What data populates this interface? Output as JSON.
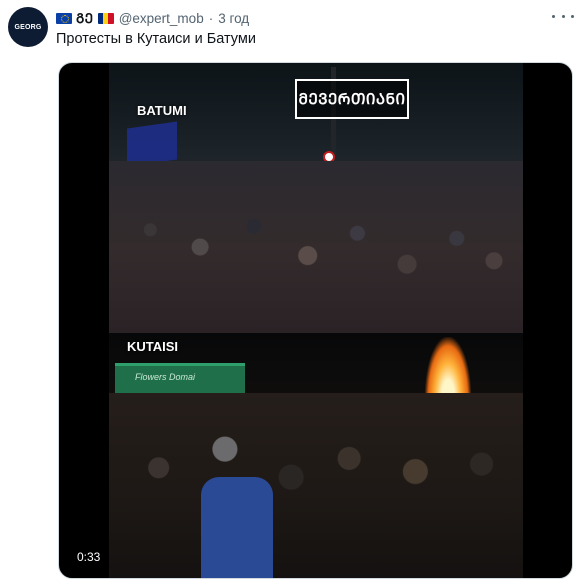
{
  "avatar": {
    "text": "GEORG"
  },
  "header": {
    "display_name": "ᲒᲔ",
    "handle": "@expert_mob",
    "separator": "·",
    "time": "3 год",
    "flags": [
      "eu-flag-icon",
      "romania-flag-icon"
    ]
  },
  "tweet": {
    "text": "Протесты в Кутаиси и Батуми"
  },
  "media": {
    "top_label": "BATUMI",
    "bottom_label": "KUTAISI",
    "sign_text": "ᲛᲔᲕᲔᲠᲗᲘᲐᲜᲘ",
    "storefront_text": "Flowers Domai",
    "duration": "0:33"
  },
  "colors": {
    "text": "#0f1419",
    "muted": "#536471",
    "romania_blue": "#002b7f",
    "romania_yellow": "#fcd116",
    "romania_red": "#ce1126"
  }
}
